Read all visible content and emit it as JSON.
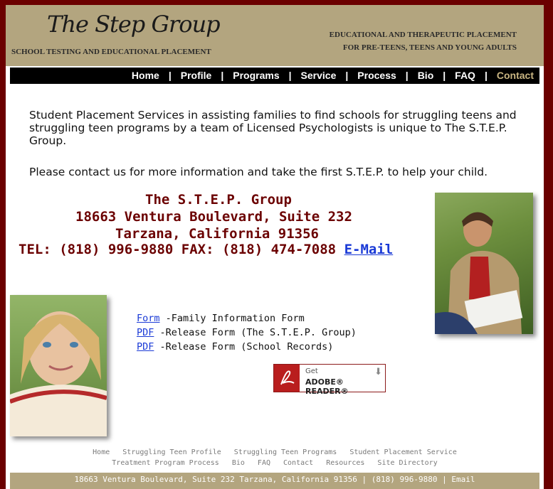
{
  "header": {
    "logo": "The Step Group",
    "subtitle": "SCHOOL TESTING AND EDUCATIONAL PLACEMENT",
    "tagline_line1": "EDUCATIONAL AND THERAPEUTIC PLACEMENT",
    "tagline_line2": "FOR PRE-TEENS, TEENS AND YOUNG ADULTS"
  },
  "nav": {
    "items": [
      "Home",
      "Profile",
      "Programs",
      "Service",
      "Process",
      "Bio",
      "FAQ",
      "Contact"
    ],
    "separator": "|",
    "active": "Contact",
    "active_color": "#c9b582"
  },
  "intro": {
    "p1": "Student Placement Services in assisting families to find schools for struggling teens and struggling teen programs by a team of Licensed Psychologists is unique to The S.T.E.P. Group.",
    "p2": "Please contact us for more information and take the first S.T.E.P. to help your child."
  },
  "address": {
    "line1": "The S.T.E.P. Group",
    "line2": "18663 Ventura Boulevard, Suite 232",
    "line3": "Tarzana, California 91356",
    "line4": "TEL: (818) 996-9880 FAX: (818) 474-7088",
    "email_link": "E-Mail",
    "color": "#6b0000"
  },
  "forms": [
    {
      "link": "Form",
      "text": " -Family Information Form"
    },
    {
      "link": "PDF",
      "text": " -Release Form (The S.T.E.P. Group)"
    },
    {
      "link": "PDF",
      "text": " -Release Form (School Records)"
    }
  ],
  "adobe": {
    "get": "Get",
    "reader": "ADOBE® READER®"
  },
  "footer": {
    "row1": [
      "Home",
      "Struggling Teen Profile",
      "Struggling Teen Programs",
      "Student Placement Service"
    ],
    "row2": [
      "Treatment Program Process",
      "Bio",
      "FAQ",
      "Contact",
      "Resources",
      "Site Directory"
    ],
    "bottom": "18663 Ventura Boulevard, Suite 232 Tarzana, California 91356 | (818) 996-9880 | Email"
  },
  "colors": {
    "background": "#6b0000",
    "header": "#b3a57f",
    "link": "#1a3ad6"
  }
}
